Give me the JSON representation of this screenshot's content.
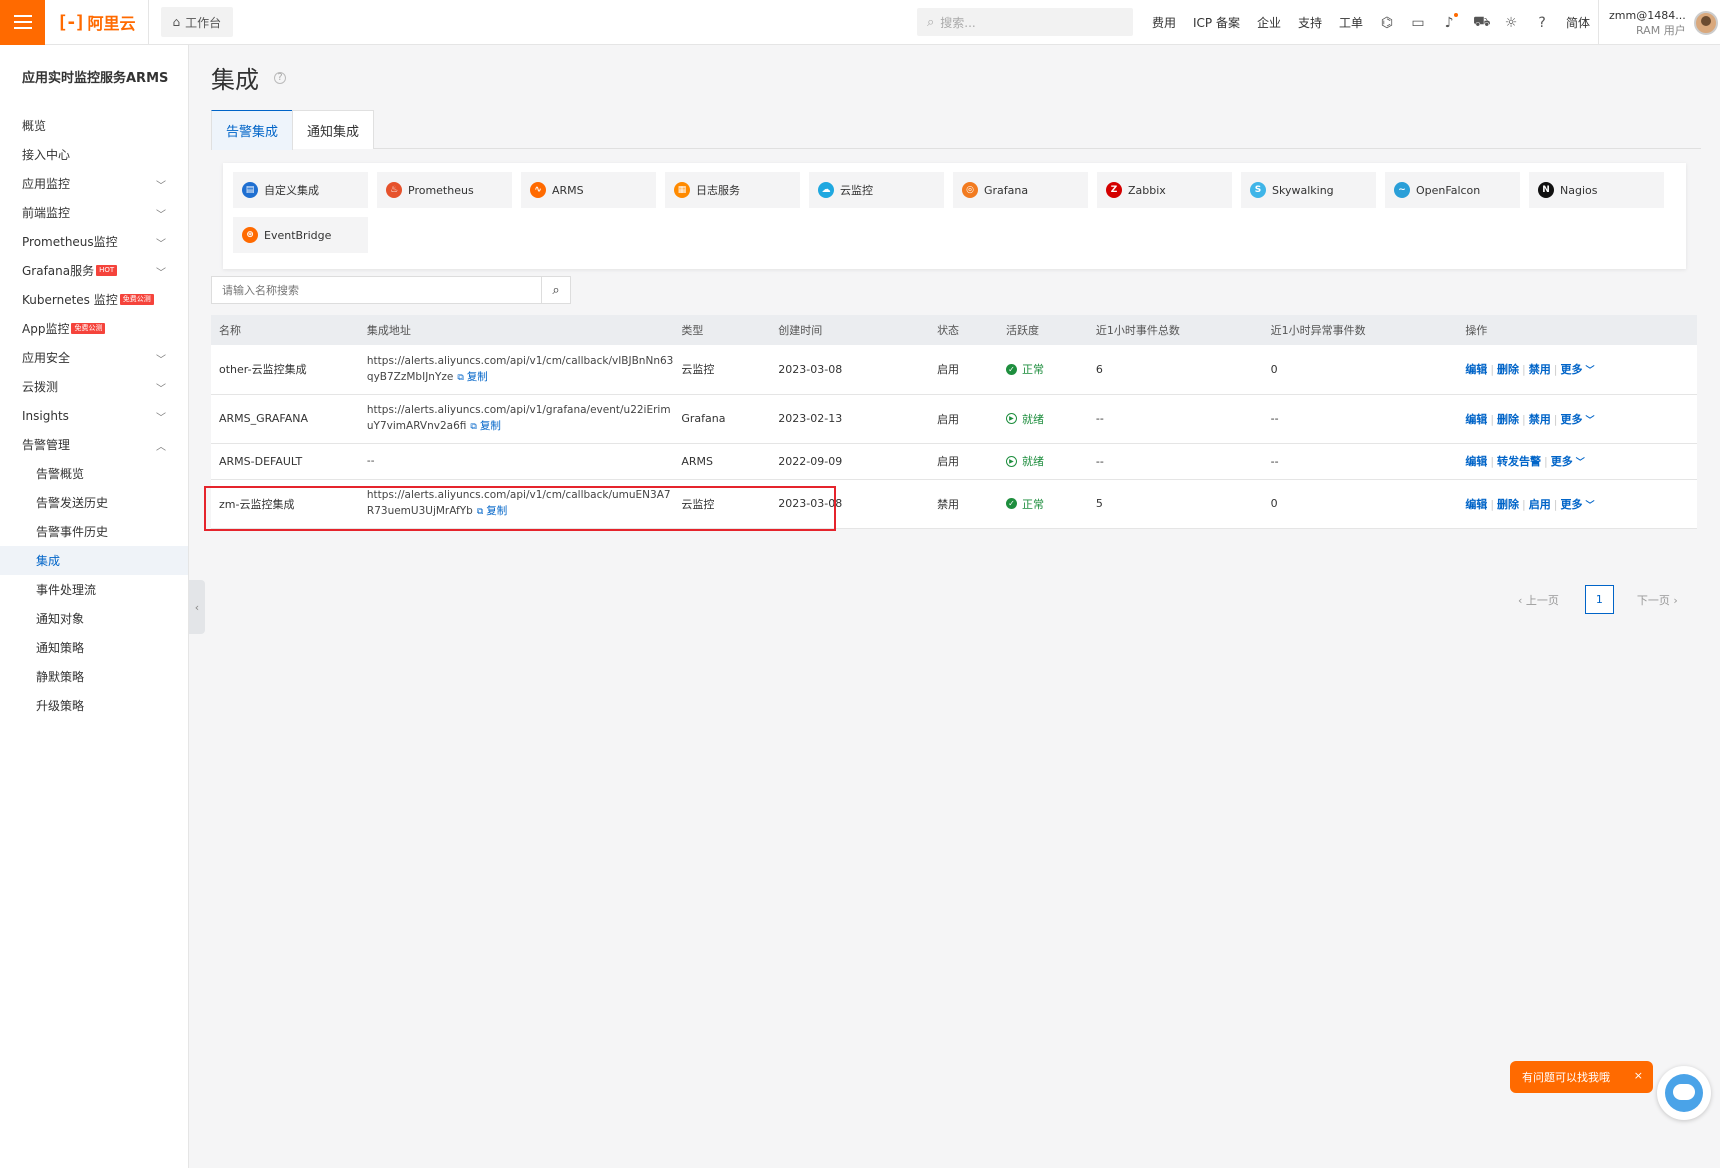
{
  "topbar": {
    "brand": "阿里云",
    "workbench": "工作台",
    "search_placeholder": "搜索...",
    "links": [
      "费用",
      "ICP 备案",
      "企业",
      "支持",
      "工单"
    ],
    "lang": "简体",
    "user_name": "zmm@1484...",
    "user_role": "RAM 用户",
    "icons": [
      "code-icon",
      "terminal-icon",
      "bell-icon",
      "cart-icon",
      "bulb-icon",
      "help-icon"
    ]
  },
  "sidebar": {
    "title": "应用实时监控服务ARMS",
    "items": [
      {
        "label": "概览",
        "chevron": false
      },
      {
        "label": "接入中心",
        "chevron": false
      },
      {
        "label": "应用监控",
        "chevron": true
      },
      {
        "label": "前端监控",
        "chevron": true
      },
      {
        "label": "Prometheus监控",
        "chevron": true
      },
      {
        "label": "Grafana服务",
        "badge": "HOT",
        "chevron": true
      },
      {
        "label": "Kubernetes 监控",
        "badge": "免费公测",
        "chevron": false
      },
      {
        "label": "App监控",
        "badge": "免费公测",
        "chevron": false
      },
      {
        "label": "应用安全",
        "chevron": true
      },
      {
        "label": "云拨测",
        "chevron": true
      },
      {
        "label": "Insights",
        "chevron": true
      },
      {
        "label": "告警管理",
        "chevron": true,
        "expanded": true
      }
    ],
    "sub_items": [
      "告警概览",
      "告警发送历史",
      "告警事件历史",
      "集成",
      "事件处理流",
      "通知对象",
      "通知策略",
      "静默策略",
      "升级策略"
    ],
    "active_sub": "集成"
  },
  "page": {
    "title": "集成",
    "tabs": [
      "告警集成",
      "通知集成"
    ],
    "active_tab": "告警集成"
  },
  "integrations": [
    {
      "name": "自定义集成",
      "color": "#1f6fd1",
      "glyph": "▤"
    },
    {
      "name": "Prometheus",
      "color": "#e6522c",
      "glyph": "♨"
    },
    {
      "name": "ARMS",
      "color": "#ff6a00",
      "glyph": "∿"
    },
    {
      "name": "日志服务",
      "color": "#ff8a00",
      "glyph": "▦"
    },
    {
      "name": "云监控",
      "color": "#1fa8e0",
      "glyph": "☁"
    },
    {
      "name": "Grafana",
      "color": "#f27b20",
      "glyph": "◎"
    },
    {
      "name": "Zabbix",
      "color": "#d40000",
      "glyph": "Z"
    },
    {
      "name": "Skywalking",
      "color": "#3fb5e8",
      "glyph": "S"
    },
    {
      "name": "OpenFalcon",
      "color": "#2a9fd8",
      "glyph": "∼"
    },
    {
      "name": "Nagios",
      "color": "#111111",
      "glyph": "N"
    },
    {
      "name": "EventBridge",
      "color": "#ff6a00",
      "glyph": "⊛"
    }
  ],
  "search": {
    "placeholder": "请输入名称搜索"
  },
  "table": {
    "headers": [
      "名称",
      "集成地址",
      "类型",
      "创建时间",
      "状态",
      "活跃度",
      "近1小时事件总数",
      "近1小时异常事件数",
      "操作"
    ],
    "copy_label": "复制",
    "more_label": "更多",
    "rows": [
      {
        "name": "other-云监控集成",
        "addr1": "https://alerts.aliyuncs.com/api/v1/cm/callback/vIBJBnNn63",
        "addr2": "qyB7ZzMbIJnYze",
        "type": "云监控",
        "date": "2023-03-08",
        "state": "启用",
        "activity": "正常",
        "activity_kind": "ok",
        "total": "6",
        "abnormal": "0",
        "ops": [
          "编辑",
          "删除",
          "禁用"
        ]
      },
      {
        "name": "ARMS_GRAFANA",
        "addr1": "https://alerts.aliyuncs.com/api/v1/grafana/event/u22iErim",
        "addr2": "uY7vimARVnv2a6fi",
        "type": "Grafana",
        "date": "2023-02-13",
        "state": "启用",
        "activity": "就绪",
        "activity_kind": "ready",
        "total": "--",
        "abnormal": "--",
        "ops": [
          "编辑",
          "删除",
          "禁用"
        ]
      },
      {
        "name": "ARMS-DEFAULT",
        "addr1": "--",
        "addr2": "",
        "type": "ARMS",
        "date": "2022-09-09",
        "state": "启用",
        "activity": "就绪",
        "activity_kind": "ready",
        "total": "--",
        "abnormal": "--",
        "ops": [
          "编辑",
          "转发告警"
        ]
      },
      {
        "name": "zm-云监控集成",
        "addr1": "https://alerts.aliyuncs.com/api/v1/cm/callback/umuEN3A7",
        "addr2": "R73uemU3UjMrAfYb",
        "type": "云监控",
        "date": "2023-03-08",
        "state": "禁用",
        "activity": "正常",
        "activity_kind": "ok",
        "total": "5",
        "abnormal": "0",
        "ops": [
          "编辑",
          "删除",
          "启用"
        ]
      }
    ]
  },
  "pager": {
    "prev": "上一页",
    "current": "1",
    "next": "下一页"
  },
  "assistant": {
    "bubble": "有问题可以找我哦",
    "close": "×"
  }
}
